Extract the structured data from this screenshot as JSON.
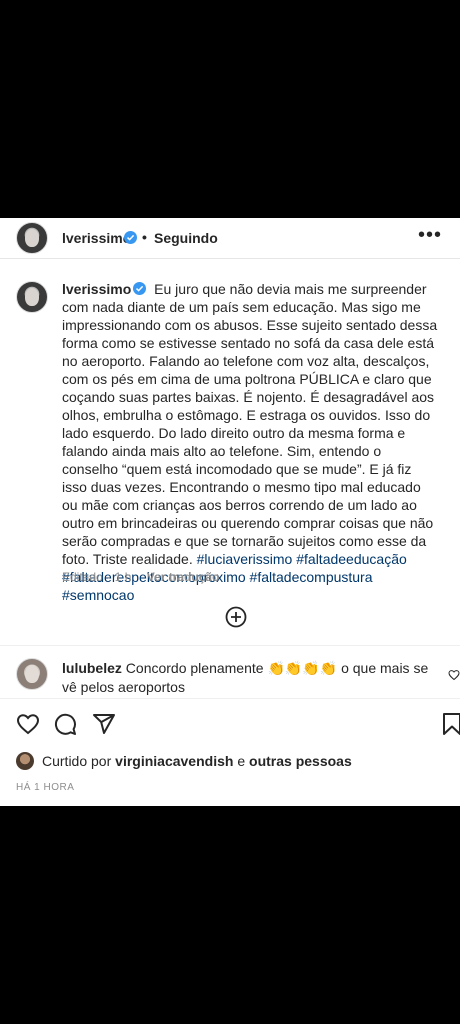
{
  "post": {
    "username": "lverissimo",
    "dot": "•",
    "follow_status": "Seguindo",
    "more": "•••"
  },
  "caption": {
    "username": "lverissimo",
    "text": "Eu juro que não devia mais me surpreender com nada diante de um país sem educação. Mas sigo me impressionando com os abusos. Esse sujeito sentado dessa forma como se estivesse sentado no sofá da casa dele está no aeroporto. Falando ao telefone com voz alta, descalços, com os pés em cima de uma poltrona PÚBLICA e claro que coçando suas partes baixas. É nojento. É desagradável aos olhos, embrulha o estômago. E estraga os ouvidos. Isso do lado esquerdo. Do lado direito outro da mesma forma e falando ainda mais alto ao telefone. Sim, entendo o conselho “quem está incomodado que se mude”. E já fiz isso duas vezes. Encontrando o mesmo tipo mal educado ou mãe com crianças aos berros correndo de um lado ao outro em brincadeiras ou querendo comprar coisas que não serão compradas e que se tornarão sujeitos como esse da foto. Triste realidade.",
    "hashtags": "#luciaverissimo #faltadeeducação #faltaderespeitocomoproximo #faltadecompustura #semnocao",
    "edited": "Editado",
    "separator": "·",
    "age": "1 h",
    "see_translation": "Ver tradução"
  },
  "comment": {
    "username": "lulubelez",
    "text_before": "Concordo plenamente",
    "emojis": "👏👏👏👏",
    "text_after": "o que mais se vê pelos aeroportos"
  },
  "likes": {
    "prefix": "Curtido por",
    "user": "virginiacavendish",
    "connector": "e",
    "others": "outras pessoas"
  },
  "timestamp": "HÁ 1 HORA",
  "colors": {
    "verified": "#3897f0",
    "hashtag": "#00376b",
    "muted": "#8e8e8e"
  }
}
